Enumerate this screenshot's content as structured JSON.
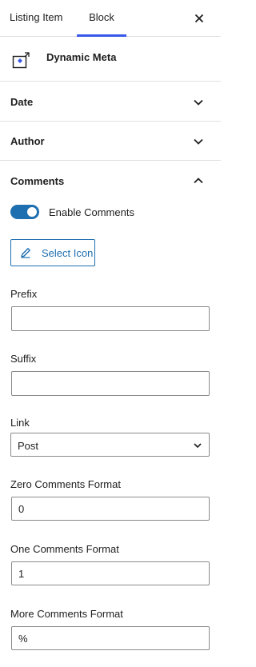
{
  "tabs": [
    {
      "label": "Listing Item",
      "active": false
    },
    {
      "label": "Block",
      "active": true
    }
  ],
  "header": {
    "close_icon": "close-icon"
  },
  "block_card": {
    "title": "Dynamic Meta",
    "icon": "dynamic-meta-tag-icon"
  },
  "panels": [
    {
      "label": "Date",
      "expanded": false
    },
    {
      "label": "Author",
      "expanded": false
    },
    {
      "label": "Comments",
      "expanded": true
    }
  ],
  "comments": {
    "toggle": {
      "label": "Enable Comments",
      "enabled": true
    },
    "select_icon_label": "Select Icon",
    "prefix": {
      "label": "Prefix",
      "value": ""
    },
    "suffix": {
      "label": "Suffix",
      "value": ""
    },
    "link": {
      "label": "Link",
      "selected": "Post"
    },
    "zero_format": {
      "label": "Zero Comments Format",
      "value": "0"
    },
    "one_format": {
      "label": "One Comments Format",
      "value": "1"
    },
    "more_format": {
      "label": "More Comments Format",
      "value": "%"
    }
  },
  "colors": {
    "accent": "#3858e9",
    "toggle": "#1e6fb0",
    "border": "#e0e0e0"
  }
}
